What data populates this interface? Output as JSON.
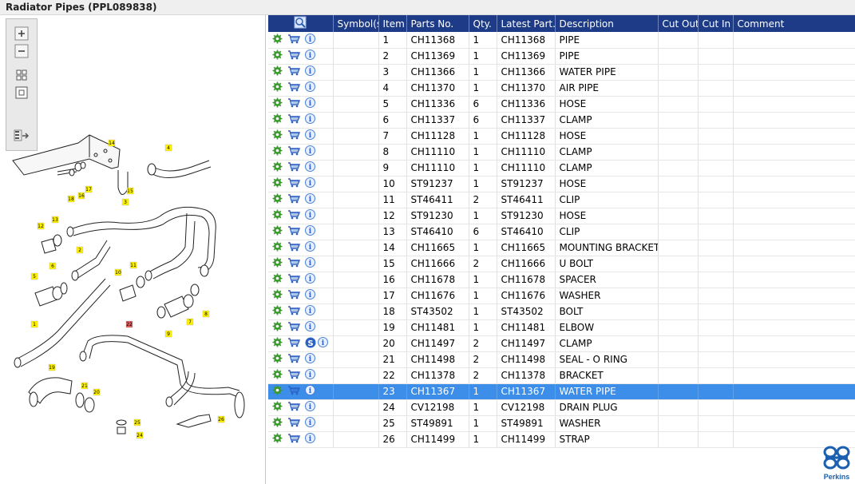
{
  "window": {
    "title": "Radiator Pipes (PPL089838)"
  },
  "toolbar": {
    "zoom_in": "zoom-in",
    "zoom_out": "zoom-out",
    "fit": "fit-page",
    "reset": "actual-size",
    "toggle": "toggle-list"
  },
  "table": {
    "headers": [
      "",
      "Symbol(s)",
      "Item",
      "Parts No.",
      "Qty.",
      "Latest Part...",
      "Description",
      "Cut Out",
      "Cut In",
      "Comment"
    ],
    "rows": [
      {
        "item": "1",
        "part": "CH11368",
        "qty": "1",
        "latest": "CH11368",
        "desc": "PIPE",
        "symbol": ""
      },
      {
        "item": "2",
        "part": "CH11369",
        "qty": "1",
        "latest": "CH11369",
        "desc": "PIPE",
        "symbol": ""
      },
      {
        "item": "3",
        "part": "CH11366",
        "qty": "1",
        "latest": "CH11366",
        "desc": "WATER PIPE",
        "symbol": ""
      },
      {
        "item": "4",
        "part": "CH11370",
        "qty": "1",
        "latest": "CH11370",
        "desc": "AIR PIPE",
        "symbol": ""
      },
      {
        "item": "5",
        "part": "CH11336",
        "qty": "6",
        "latest": "CH11336",
        "desc": "HOSE",
        "symbol": ""
      },
      {
        "item": "6",
        "part": "CH11337",
        "qty": "6",
        "latest": "CH11337",
        "desc": "CLAMP",
        "symbol": ""
      },
      {
        "item": "7",
        "part": "CH11128",
        "qty": "1",
        "latest": "CH11128",
        "desc": "HOSE",
        "symbol": ""
      },
      {
        "item": "8",
        "part": "CH11110",
        "qty": "1",
        "latest": "CH11110",
        "desc": "CLAMP",
        "symbol": ""
      },
      {
        "item": "9",
        "part": "CH11110",
        "qty": "1",
        "latest": "CH11110",
        "desc": "CLAMP",
        "symbol": ""
      },
      {
        "item": "10",
        "part": "ST91237",
        "qty": "1",
        "latest": "ST91237",
        "desc": "HOSE",
        "symbol": ""
      },
      {
        "item": "11",
        "part": "ST46411",
        "qty": "2",
        "latest": "ST46411",
        "desc": "CLIP",
        "symbol": ""
      },
      {
        "item": "12",
        "part": "ST91230",
        "qty": "1",
        "latest": "ST91230",
        "desc": "HOSE",
        "symbol": ""
      },
      {
        "item": "13",
        "part": "ST46410",
        "qty": "6",
        "latest": "ST46410",
        "desc": "CLIP",
        "symbol": ""
      },
      {
        "item": "14",
        "part": "CH11665",
        "qty": "1",
        "latest": "CH11665",
        "desc": "MOUNTING BRACKET",
        "symbol": ""
      },
      {
        "item": "15",
        "part": "CH11666",
        "qty": "2",
        "latest": "CH11666",
        "desc": "U BOLT",
        "symbol": ""
      },
      {
        "item": "16",
        "part": "CH11678",
        "qty": "1",
        "latest": "CH11678",
        "desc": "SPACER",
        "symbol": ""
      },
      {
        "item": "17",
        "part": "CH11676",
        "qty": "1",
        "latest": "CH11676",
        "desc": "WASHER",
        "symbol": ""
      },
      {
        "item": "18",
        "part": "ST43502",
        "qty": "1",
        "latest": "ST43502",
        "desc": "BOLT",
        "symbol": ""
      },
      {
        "item": "19",
        "part": "CH11481",
        "qty": "1",
        "latest": "CH11481",
        "desc": "ELBOW",
        "symbol": ""
      },
      {
        "item": "20",
        "part": "CH11497",
        "qty": "2",
        "latest": "CH11497",
        "desc": "CLAMP",
        "symbol": "S"
      },
      {
        "item": "21",
        "part": "CH11498",
        "qty": "2",
        "latest": "CH11498",
        "desc": "SEAL - O RING",
        "symbol": ""
      },
      {
        "item": "22",
        "part": "CH11378",
        "qty": "2",
        "latest": "CH11378",
        "desc": "BRACKET",
        "symbol": ""
      },
      {
        "item": "23",
        "part": "CH11367",
        "qty": "1",
        "latest": "CH11367",
        "desc": "WATER PIPE",
        "symbol": ""
      },
      {
        "item": "24",
        "part": "CV12198",
        "qty": "1",
        "latest": "CV12198",
        "desc": "DRAIN PLUG",
        "symbol": ""
      },
      {
        "item": "25",
        "part": "ST49891",
        "qty": "1",
        "latest": "ST49891",
        "desc": "WASHER",
        "symbol": ""
      },
      {
        "item": "26",
        "part": "CH11499",
        "qty": "1",
        "latest": "CH11499",
        "desc": "STRAP",
        "symbol": ""
      }
    ],
    "selected_item": "23"
  },
  "diagram": {
    "callouts": [
      "14",
      "4",
      "17",
      "15",
      "16",
      "18",
      "3",
      "13",
      "12",
      "2",
      "11",
      "10",
      "6",
      "5",
      "7",
      "8",
      "9",
      "1",
      "22",
      "19",
      "21",
      "20",
      "25",
      "26",
      "24"
    ]
  },
  "logo": {
    "text": "Perkins"
  },
  "colors": {
    "header": "#1d3b87",
    "selected": "#3d8ee8",
    "callout": "#fff200",
    "callout_red": "#e05a5a"
  }
}
